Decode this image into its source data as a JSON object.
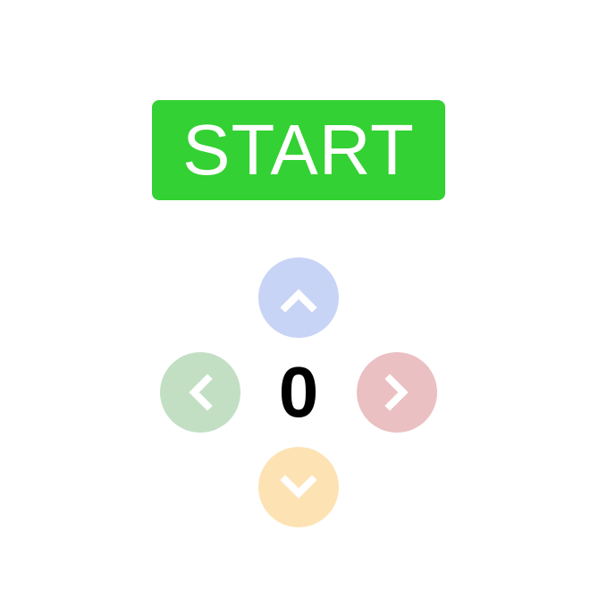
{
  "start_button": {
    "label": "START",
    "color": "#33d133"
  },
  "score": {
    "value": "0"
  },
  "dpad": {
    "up": {
      "icon": "chevron-up-icon",
      "color": "#c8d4f5"
    },
    "left": {
      "icon": "chevron-left-icon",
      "color": "#c2dfc4"
    },
    "right": {
      "icon": "chevron-right-icon",
      "color": "#ebc0c2"
    },
    "down": {
      "icon": "chevron-down-icon",
      "color": "#fde3b4"
    }
  }
}
